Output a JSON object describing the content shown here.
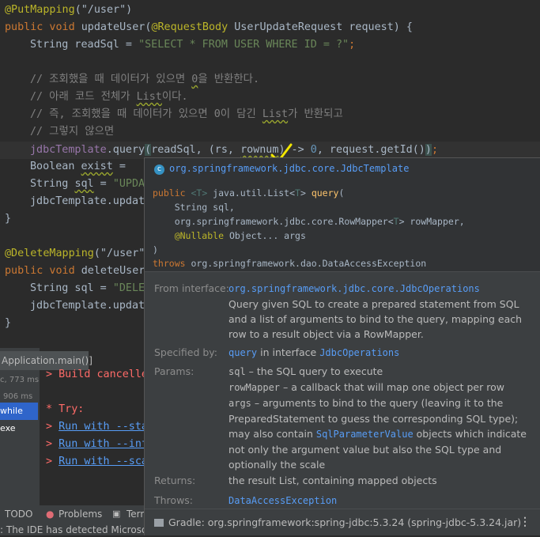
{
  "editor": {
    "l1": {
      "ann": "@PutMapping",
      "rest": "(\"/user\")"
    },
    "l2": {
      "kw": "public void ",
      "name": "updateUser(",
      "ann": "@RequestBody",
      "rest": " UserUpdateRequest request) {"
    },
    "l3": {
      "a": "String readSql = ",
      "str": "\"SELECT * FROM USER WHERE ID = ?\"",
      "end": ";"
    },
    "c1": {
      "a": "// 조회했을 때 데이터가 있으면 ",
      "b": "0",
      "c": "을 반환한다."
    },
    "c2": {
      "a": "// 아래 코드 전체가 ",
      "b": "List",
      "c": "이다."
    },
    "c3": {
      "a": "// 즉, 조회했을 때 데이터가 있으면 0이 담긴 ",
      "b": "List",
      "c": "가 반환되고"
    },
    "c4": "// 그렇지 않으면",
    "q": {
      "a": "jdbcTemplate",
      "b": ".query",
      "c": "(",
      "d": "readSql, (rs, ",
      "e": "rownum",
      "f": ") -> ",
      "g": "0",
      "h": ", request.getId()",
      "i": ")",
      "j": ";"
    },
    "l9": {
      "a": "Boolean ",
      "b": "exist",
      "c": " ="
    },
    "l10": {
      "a": "String ",
      "b": "sql",
      "c": " = ",
      "d": "\"UPDA"
    },
    "l11": "jdbcTemplate.updat",
    "l12": "}",
    "l13": {
      "ann": "@DeleteMapping",
      "rest": "(\"/user\""
    },
    "l14": {
      "kw": "public void ",
      "name": "deleteUser"
    },
    "l15": {
      "a": "String sql = ",
      "str": "\"DELE"
    },
    "l16": "jdbcTemplate.updat",
    "l17": "}"
  },
  "run_panel": {
    "tab": "Application.main()]",
    "time1": "c, 773 ms",
    "time2": "906 ms",
    "selected": "while exe",
    "build_cancelled": "> Build cancelle",
    "try": "* Try:",
    "run1_prefix": "> ",
    "run1": "Run with --sta",
    "run2_prefix": "> ",
    "run2": "Run with --inf",
    "run3_prefix": "> ",
    "run3": "Run with --sca"
  },
  "statusbar": {
    "todo": "TODO",
    "problems": "Problems",
    "terminal": "Term",
    "message": ": The IDE has detected Microsoft I"
  },
  "popup": {
    "class_name": "org.springframework.jdbc.core.JdbcTemplate",
    "sig1": {
      "k": "public ",
      "g1": "<T>",
      "t": " java.util.List<",
      "g2": "T",
      "t2": "> ",
      "m": "query",
      "p": "("
    },
    "sig2": "    String sql,",
    "sig3": {
      "a": "    org.springframework.jdbc.core.RowMapper<",
      "g": "T",
      "b": "> rowMapper,"
    },
    "sig4": {
      "a": "    @Nullable",
      "b": " Object... args"
    },
    "sig5": ")",
    "sig6": {
      "k": "throws",
      "b": " org.springframework.dao.DataAccessException"
    },
    "from_interface_label": "From interface:",
    "from_interface_link": "org.springframework.jdbc.core.JdbcOperations",
    "description": "Query given SQL to create a prepared statement from SQL and a list of arguments to bind to the query, mapping each row to a result object via a RowMapper.",
    "specified_by_label": "Specified by:",
    "specified_by_method": "query",
    "specified_by_mid": " in interface ",
    "specified_by_iface": "JdbcOperations",
    "params_label": "Params:",
    "param1_name": "sql",
    "param1_text": " – the SQL query to execute",
    "param2_name": "rowMapper",
    "param2_text": " – a callback that will map one object per row",
    "param3_name": "args",
    "param3_text": " – arguments to bind to the query (leaving it to the PreparedStatement to guess the corresponding SQL type); may also contain ",
    "param3_link": "SqlParameterValue",
    "param3_tail": " objects which indicate not only the argument value but also the SQL type and optionally the scale",
    "returns_label": "Returns:",
    "returns_text": "the result List, containing mapped objects",
    "throws_label": "Throws:",
    "throws_link": "DataAccessException",
    "gradle": "Gradle: org.springframework:spring-jdbc:5.3.24 (spring-jdbc-5.3.24.jar)",
    "more": "⋮"
  },
  "colors": {
    "checkmark": "#f2e600",
    "link": "#589df6"
  }
}
